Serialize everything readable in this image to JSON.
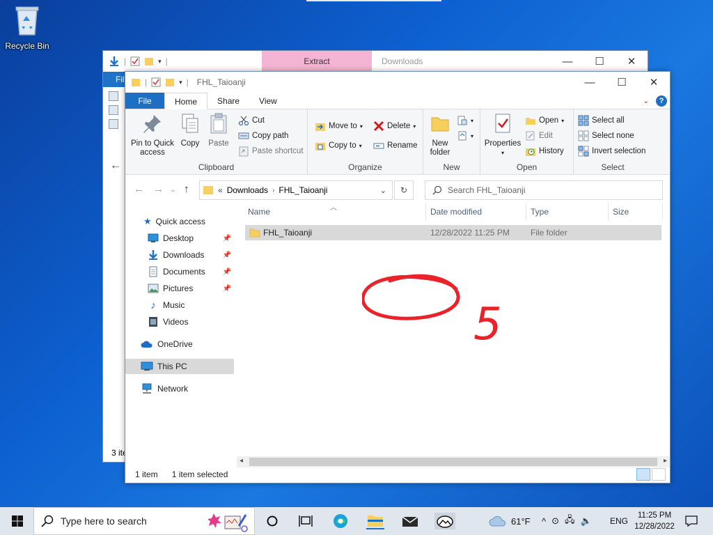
{
  "desktop": {
    "recycle_bin_label": "Recycle Bin"
  },
  "back_window": {
    "extract_tab": "Extract",
    "title": "Downloads",
    "file_tab": "File",
    "status": "3 items"
  },
  "window": {
    "title": "FHL_Taioanji",
    "tabs": {
      "file": "File",
      "home": "Home",
      "share": "Share",
      "view": "View"
    },
    "ribbon": {
      "clipboard": {
        "pin_quick_access": "Pin to Quick access",
        "copy": "Copy",
        "paste": "Paste",
        "cut": "Cut",
        "copy_path": "Copy path",
        "paste_shortcut": "Paste shortcut",
        "label": "Clipboard"
      },
      "organize": {
        "move_to": "Move to",
        "copy_to": "Copy to",
        "delete": "Delete",
        "rename": "Rename",
        "label": "Organize"
      },
      "new": {
        "new_folder": "New folder",
        "label": "New"
      },
      "open": {
        "properties": "Properties",
        "open": "Open",
        "edit": "Edit",
        "history": "History",
        "label": "Open"
      },
      "select": {
        "select_all": "Select all",
        "select_none": "Select none",
        "invert_selection": "Invert selection",
        "label": "Select"
      }
    },
    "address": {
      "prefix": "«",
      "crumbs": [
        "Downloads",
        "FHL_Taioanji"
      ],
      "search_placeholder": "Search FHL_Taioanji"
    },
    "nav": {
      "quick_access": "Quick access",
      "desktop": "Desktop",
      "downloads": "Downloads",
      "documents": "Documents",
      "pictures": "Pictures",
      "music": "Music",
      "videos": "Videos",
      "onedrive": "OneDrive",
      "this_pc": "This PC",
      "network": "Network"
    },
    "columns": {
      "name": "Name",
      "date_modified": "Date modified",
      "type": "Type",
      "size": "Size"
    },
    "files": [
      {
        "name": "FHL_Taioanji",
        "date_modified": "12/28/2022 11:25 PM",
        "type": "File folder",
        "size": ""
      }
    ],
    "status": {
      "count": "1 item",
      "selected": "1 item selected"
    }
  },
  "annotation": {
    "text": "5",
    "color": "#e8232a"
  },
  "taskbar": {
    "search_placeholder": "Type here to search",
    "weather": "61°F",
    "language": "ENG",
    "time": "11:25 PM",
    "date": "12/28/2022"
  },
  "colors": {
    "accent": "#1d6fc4",
    "selection": "#d9d9d9",
    "folder": "#f6cf5c"
  }
}
